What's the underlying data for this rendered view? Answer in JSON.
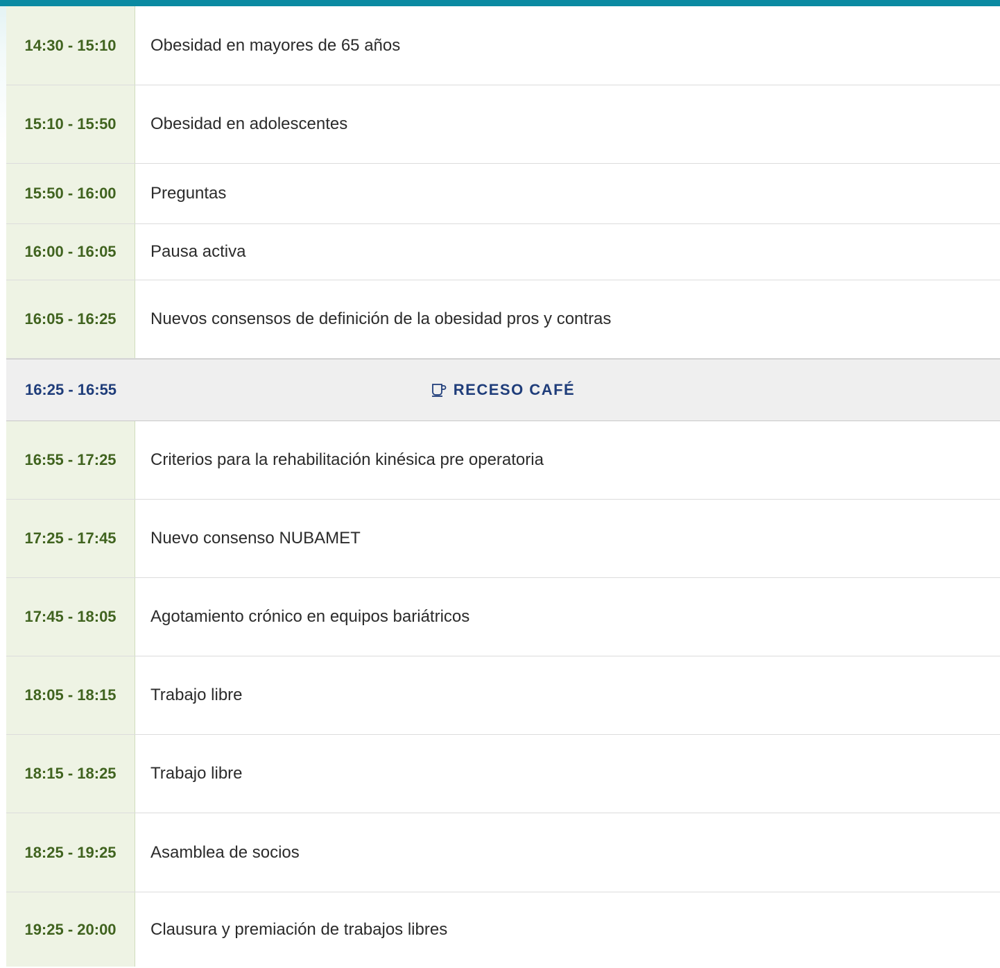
{
  "schedule": [
    {
      "time": "14:30 - 15:10",
      "title": "Obesidad en mayores de 65 años"
    },
    {
      "time": "15:10 - 15:50",
      "title": "Obesidad en adolescentes"
    },
    {
      "time": "15:50 - 16:00",
      "title": "Preguntas"
    },
    {
      "time": "16:00 - 16:05",
      "title": "Pausa activa"
    },
    {
      "time": "16:05 - 16:25",
      "title": "Nuevos consensos de definición de la obesidad pros y contras"
    },
    {
      "time": "16:25 - 16:55",
      "title": "RECESO CAFÉ",
      "icon": "coffee-cup-icon"
    },
    {
      "time": "16:55 - 17:25",
      "title": "Criterios para la rehabilitación kinésica pre operatoria"
    },
    {
      "time": "17:25 - 17:45",
      "title": "Nuevo consenso NUBAMET"
    },
    {
      "time": "17:45 - 18:05",
      "title": "Agotamiento crónico en equipos bariátricos"
    },
    {
      "time": "18:05 - 18:15",
      "title": "Trabajo libre"
    },
    {
      "time": "18:15 - 18:25",
      "title": "Trabajo libre"
    },
    {
      "time": "18:25 - 19:25",
      "title": "Asamblea de socios"
    },
    {
      "time": "19:25 - 20:00",
      "title": "Clausura y premiación de trabajos libres"
    }
  ],
  "colors": {
    "top_bar": "#0b8aa2",
    "time_bg": "#eef3e4",
    "time_text": "#40631f",
    "break_bg": "#efefef",
    "break_text": "#1f3d7a"
  }
}
